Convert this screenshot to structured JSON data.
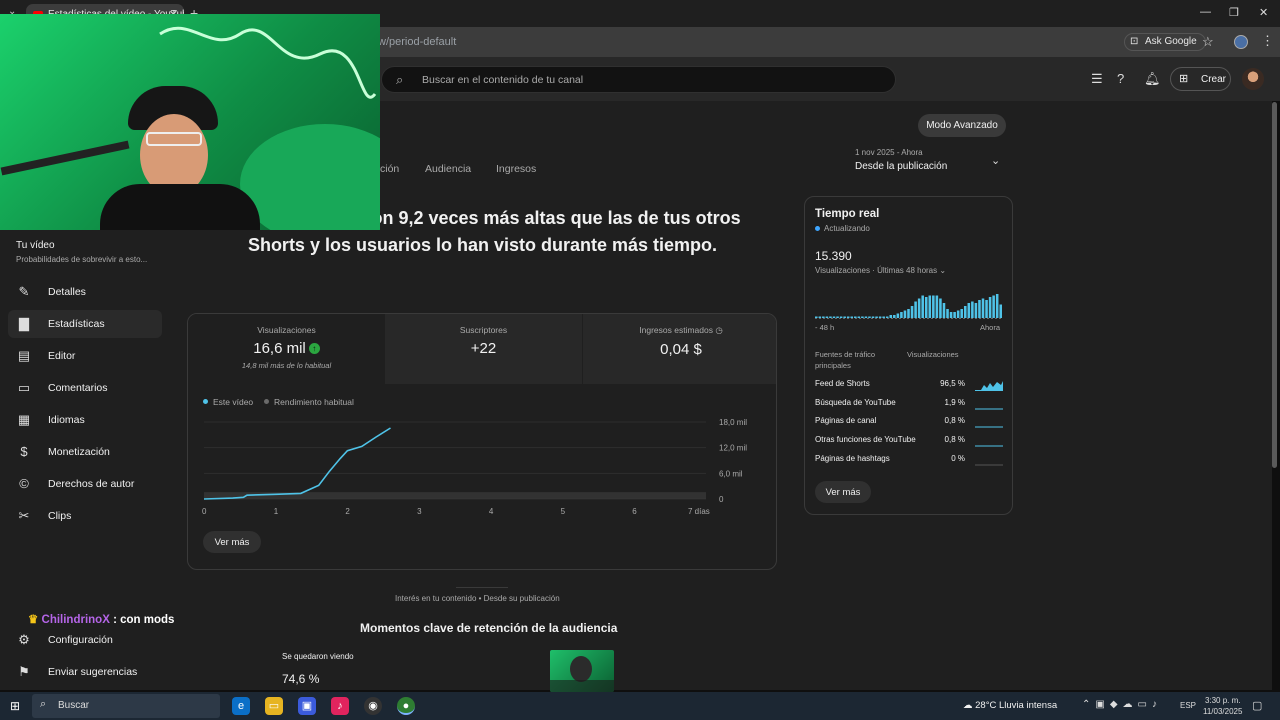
{
  "browser": {
    "tab_title": "Estadísticas del vídeo - YouTube",
    "url": "w/period-default",
    "ask_google": "Ask Google"
  },
  "header": {
    "search_placeholder": "Buscar en el contenido de tu canal",
    "create_label": "Crear"
  },
  "sidebar": {
    "video_title": "Tu vídeo",
    "video_subtitle": "Probabilidades de sobrevivir a esto...",
    "items": [
      {
        "label": "Detalles",
        "icon": "pencil-icon"
      },
      {
        "label": "Estadísticas",
        "icon": "analytics-icon"
      },
      {
        "label": "Editor",
        "icon": "clapper-icon"
      },
      {
        "label": "Comentarios",
        "icon": "comment-icon"
      },
      {
        "label": "Idiomas",
        "icon": "subtitles-icon"
      },
      {
        "label": "Monetización",
        "icon": "dollar-icon"
      },
      {
        "label": "Derechos de autor",
        "icon": "copyright-icon"
      },
      {
        "label": "Clips",
        "icon": "scissors-icon"
      }
    ],
    "settings_label": "Configuración",
    "feedback_label": "Enviar sugerencias"
  },
  "main": {
    "advanced_mode": "Modo Avanzado",
    "tabs": [
      "ción",
      "Audiencia",
      "Ingresos"
    ],
    "period_range": "1 nov 2025 - Ahora",
    "period_label": "Desde la publicación",
    "headline": "visualizaciones son 9,2 veces más altas que las de tus otros Shorts y los usuarios lo han visto durante más tiempo.",
    "metrics": [
      {
        "label": "Visualizaciones",
        "value": "16,6 mil",
        "sub": "14,8 mil más de lo habitual"
      },
      {
        "label": "Suscriptores",
        "value": "+22"
      },
      {
        "label": "Ingresos estimados",
        "value": "0,04 $"
      }
    ],
    "legend_this": "Este vídeo",
    "legend_typical": "Rendimiento habitual",
    "see_more": "Ver más",
    "bottom_label": "Interés en tu contenido • Desde su publicación",
    "retention_title": "Momentos clave de retención de la audiencia",
    "stayed_label": "Se quedaron viendo",
    "stayed_value": "74,6 %"
  },
  "chart_data": {
    "type": "line",
    "x_tick_labels": [
      "0",
      "1",
      "2",
      "3",
      "4",
      "5",
      "6",
      "7 días"
    ],
    "y_tick_labels": [
      "18,0 mil",
      "12,0 mil",
      "6,0 mil",
      "0"
    ],
    "ylim": [
      0,
      18000
    ],
    "xlim": [
      0,
      7
    ],
    "series": [
      {
        "name": "Este vídeo",
        "color": "#4fc3e8",
        "x": [
          0,
          0.4,
          0.55,
          0.6,
          1.0,
          1.35,
          1.6,
          1.75,
          1.9,
          2.0,
          2.2,
          2.4,
          2.6
        ],
        "y": [
          0,
          200,
          400,
          900,
          1100,
          1300,
          3200,
          6500,
          9500,
          11300,
          12300,
          14500,
          16600
        ]
      },
      {
        "name": "Rendimiento habitual",
        "color": "#5a5a5a",
        "x": [
          0,
          7
        ],
        "y": [
          1600,
          1600
        ]
      }
    ],
    "grid": true
  },
  "realtime": {
    "title": "Tiempo real",
    "status": "Actualizando",
    "count": "15.390",
    "subtitle": "Visualizaciones · Últimas 48 horas",
    "axis_start": "- 48 h",
    "axis_end": "Ahora",
    "col_sources": "Fuentes de tráfico principales",
    "col_views": "Visualizaciones",
    "sources": [
      {
        "label": "Feed de Shorts",
        "pct": "96,5 %"
      },
      {
        "label": "Búsqueda de YouTube",
        "pct": "1,9 %"
      },
      {
        "label": "Páginas de canal",
        "pct": "0,8 %"
      },
      {
        "label": "Otras funciones de YouTube",
        "pct": "0,8 %"
      },
      {
        "label": "Páginas de hashtags",
        "pct": "0 %"
      }
    ],
    "bars": [
      1,
      1,
      1,
      1,
      1,
      1,
      1,
      1,
      1,
      1,
      1,
      1,
      1,
      1,
      1,
      1,
      1,
      1,
      1,
      1,
      1,
      2,
      2,
      3,
      4,
      5,
      6,
      8,
      11,
      13,
      15,
      14,
      15,
      15,
      15,
      13,
      10,
      6,
      4,
      4,
      5,
      6,
      8,
      10,
      11,
      10,
      12,
      13,
      12,
      14,
      15,
      16,
      9
    ],
    "see_more": "Ver más"
  },
  "overlay": {
    "chat_user": "ChilindrinoX",
    "chat_msg": " : con mods"
  },
  "taskbar": {
    "search": "Buscar",
    "weather": "28°C  Lluvia intensa",
    "lang": "ESP",
    "time": "3:30 p. m.",
    "date": "11/03/2025"
  }
}
